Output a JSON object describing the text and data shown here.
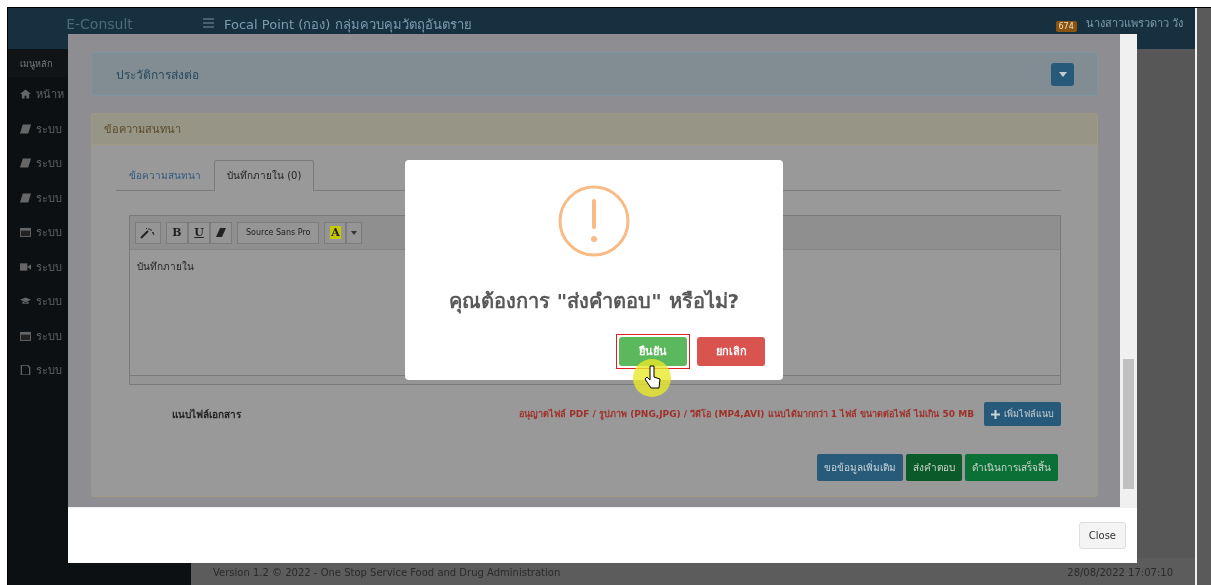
{
  "app": {
    "logo": "E-Consult",
    "page_title": "Focal Point (กอง) กลุ่มควบคุมวัตถุอันตราย",
    "notification_count": "674",
    "user_name": "นางสาวแพรวดาว วัง"
  },
  "sidebar": {
    "heading": "เมนูหลัก",
    "items": [
      {
        "kind": "home",
        "label": "หน้าห"
      },
      {
        "kind": "book",
        "label": "ระบบ"
      },
      {
        "kind": "book",
        "label": "ระบบ"
      },
      {
        "kind": "book",
        "label": "ระบบ"
      },
      {
        "kind": "calendar",
        "label": "ระบบ"
      },
      {
        "kind": "video",
        "label": "ระบบ"
      },
      {
        "kind": "cap",
        "label": "ระบบ"
      },
      {
        "kind": "calendar",
        "label": "ระบบ"
      },
      {
        "kind": "file",
        "label": "ระบบ"
      }
    ]
  },
  "footer": {
    "version": "Version 1.2 © 2022 - One Stop Service Food and Drug Administration",
    "datetime": "28/08/2022 17:07:10"
  },
  "modal": {
    "history_panel": {
      "title": "ประวัติการส่งต่อ"
    },
    "chat_panel": {
      "title": "ข้อความสนทนา",
      "tabs": [
        {
          "label": "ข้อความสนทนา",
          "selected": false
        },
        {
          "label": "บันทึกภายใน (0)",
          "selected": true
        }
      ],
      "editor": {
        "toolbar": {
          "bold": "B",
          "underline": "U",
          "font": "Source Sans Pro",
          "text_color_label": "A"
        },
        "value": "บันทึกภายใน"
      },
      "attach_label": "แนบไฟล์เอกสาร",
      "attach_note": "อนุญาตไฟล์ PDF / รูปภาพ (PNG,JPG) / วีดีโอ (MP4,AVI) แนบได้มากกว่า 1 ไฟล์ ขนาดต่อไฟล์ ไม่เกิน 50 MB",
      "add_file_button": "เพิ่มไฟล์แนบ",
      "actions": [
        {
          "kind": "info",
          "label": "ขอข้อมูลเพิ่มเติม"
        },
        {
          "kind": "send",
          "label": "ส่งคำตอบ"
        },
        {
          "kind": "done",
          "label": "ดำเนินการเสร็จสิ้น"
        }
      ]
    },
    "close_button": "Close"
  },
  "dialog": {
    "message": "คุณต้องการ \"ส่งคำตอบ\" หรือไม่?",
    "buttons": [
      {
        "kind": "confirm",
        "label": "ยืนยัน",
        "focused": true
      },
      {
        "kind": "cancel",
        "label": "ยกเลิก",
        "focused": false
      }
    ]
  }
}
